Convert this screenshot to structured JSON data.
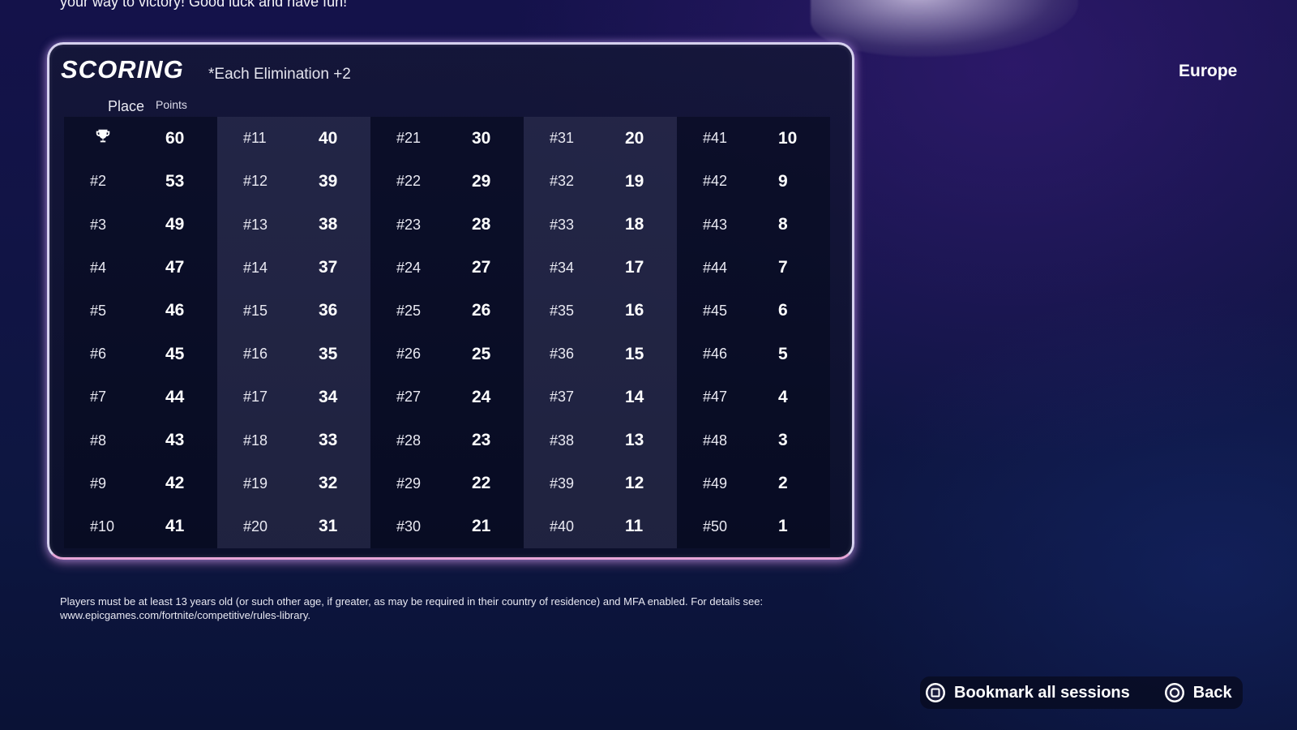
{
  "intro": {
    "text": "your way to victory! Good luck and have fun!"
  },
  "region": {
    "label": "Europe"
  },
  "scoring": {
    "title": "SCORING",
    "elimination_note": "*Each Elimination +2",
    "headers": {
      "place": "Place",
      "points": "Points"
    },
    "first_place_icon": "trophy-icon",
    "groups": [
      {
        "shaded": false,
        "rows": [
          {
            "place": "",
            "points": "60"
          },
          {
            "place": "#2",
            "points": "53"
          },
          {
            "place": "#3",
            "points": "49"
          },
          {
            "place": "#4",
            "points": "47"
          },
          {
            "place": "#5",
            "points": "46"
          },
          {
            "place": "#6",
            "points": "45"
          },
          {
            "place": "#7",
            "points": "44"
          },
          {
            "place": "#8",
            "points": "43"
          },
          {
            "place": "#9",
            "points": "42"
          },
          {
            "place": "#10",
            "points": "41"
          }
        ]
      },
      {
        "shaded": true,
        "rows": [
          {
            "place": "#11",
            "points": "40"
          },
          {
            "place": "#12",
            "points": "39"
          },
          {
            "place": "#13",
            "points": "38"
          },
          {
            "place": "#14",
            "points": "37"
          },
          {
            "place": "#15",
            "points": "36"
          },
          {
            "place": "#16",
            "points": "35"
          },
          {
            "place": "#17",
            "points": "34"
          },
          {
            "place": "#18",
            "points": "33"
          },
          {
            "place": "#19",
            "points": "32"
          },
          {
            "place": "#20",
            "points": "31"
          }
        ]
      },
      {
        "shaded": false,
        "rows": [
          {
            "place": "#21",
            "points": "30"
          },
          {
            "place": "#22",
            "points": "29"
          },
          {
            "place": "#23",
            "points": "28"
          },
          {
            "place": "#24",
            "points": "27"
          },
          {
            "place": "#25",
            "points": "26"
          },
          {
            "place": "#26",
            "points": "25"
          },
          {
            "place": "#27",
            "points": "24"
          },
          {
            "place": "#28",
            "points": "23"
          },
          {
            "place": "#29",
            "points": "22"
          },
          {
            "place": "#30",
            "points": "21"
          }
        ]
      },
      {
        "shaded": true,
        "rows": [
          {
            "place": "#31",
            "points": "20"
          },
          {
            "place": "#32",
            "points": "19"
          },
          {
            "place": "#33",
            "points": "18"
          },
          {
            "place": "#34",
            "points": "17"
          },
          {
            "place": "#35",
            "points": "16"
          },
          {
            "place": "#36",
            "points": "15"
          },
          {
            "place": "#37",
            "points": "14"
          },
          {
            "place": "#38",
            "points": "13"
          },
          {
            "place": "#39",
            "points": "12"
          },
          {
            "place": "#40",
            "points": "11"
          }
        ]
      },
      {
        "shaded": false,
        "rows": [
          {
            "place": "#41",
            "points": "10"
          },
          {
            "place": "#42",
            "points": "9"
          },
          {
            "place": "#43",
            "points": "8"
          },
          {
            "place": "#44",
            "points": "7"
          },
          {
            "place": "#45",
            "points": "6"
          },
          {
            "place": "#46",
            "points": "5"
          },
          {
            "place": "#47",
            "points": "4"
          },
          {
            "place": "#48",
            "points": "3"
          },
          {
            "place": "#49",
            "points": "2"
          },
          {
            "place": "#50",
            "points": "1"
          }
        ]
      }
    ]
  },
  "disclaimer": {
    "text": "Players must be at least 13 years old (or such other age, if greater, as may be required in their country of residence) and MFA enabled. For details see: www.epicgames.com/fortnite/competitive/rules-library."
  },
  "footer": {
    "bookmark_label": "Bookmark all sessions",
    "bookmark_icon": "square-button-icon",
    "back_label": "Back",
    "back_icon": "circle-button-icon"
  },
  "colors": {
    "panel_border": "#d6d1ee",
    "panel_glow": "#e7a6d8",
    "background": "#111445"
  }
}
